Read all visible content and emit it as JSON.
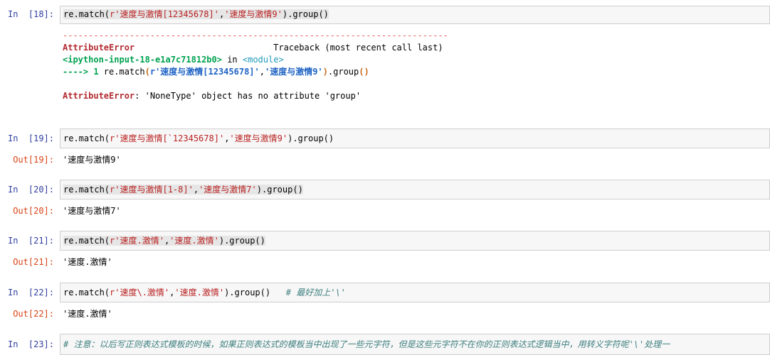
{
  "cells": [
    {
      "prompt": "In  [18]:",
      "code": {
        "pre": "re.match(",
        "s1": "r'速度与激情[12345678]'",
        "sep": ",",
        "s2": "'速度与激情9'",
        "post": ").group()"
      }
    },
    {
      "prompt": "In  [19]:",
      "code": {
        "pre": "re.match(",
        "s1": "r'速度与激情[`12345678]'",
        "sep": ",",
        "s2": "'速度与激情9'",
        "post": ").group()"
      },
      "out_prompt": "Out[19]:",
      "output": "'速度与激情9'"
    },
    {
      "prompt": "In  [20]:",
      "code": {
        "pre": "re.match(",
        "s1": "r'速度与激情[1-8]'",
        "sep": ",",
        "s2": "'速度与激情7'",
        "post": ").group()"
      },
      "out_prompt": "Out[20]:",
      "output": "'速度与激情7'"
    },
    {
      "prompt": "In  [21]:",
      "code": {
        "pre": "re.match(",
        "s1": "r'速度.激情'",
        "sep": ",",
        "s2": "'速度.激情'",
        "post": ").group()"
      },
      "out_prompt": "Out[21]:",
      "output": "'速度.激情'"
    },
    {
      "prompt": "In  [22]:",
      "code": {
        "pre": "re.match(",
        "s1": "r'速度\\.激情'",
        "sep": ",",
        "s2": "'速度.激情'",
        "post": ").group()   ",
        "comment": "# 最好加上'\\'"
      },
      "out_prompt": "Out[22]:",
      "output": "'速度.激情'"
    },
    {
      "prompt": "In  [23]:",
      "comment": "# 注意：以后写正则表达式模板的时候，如果正则表达式的模板当中出现了一些元字符，但是这些元字符不在你的正则表达式逻辑当中，用转义字符呢'\\'处理一"
    }
  ],
  "traceback": {
    "dashes": "---------------------------------------------------------------------------",
    "error_name": "AttributeError",
    "traceback_label": "Traceback (most recent call last)",
    "input_ref": "<ipython-input-18-e1a7c71812b0>",
    "in_word": " in ",
    "module": "<module>",
    "arrow": "----> 1 ",
    "call_pre": "re.match",
    "call_s1": "r'速度与激情[12345678]'",
    "call_sep": ",",
    "call_s2": "'速度与激情9'",
    "call_post": ".group",
    "message": ": 'NoneType' object has no attribute 'group'"
  }
}
